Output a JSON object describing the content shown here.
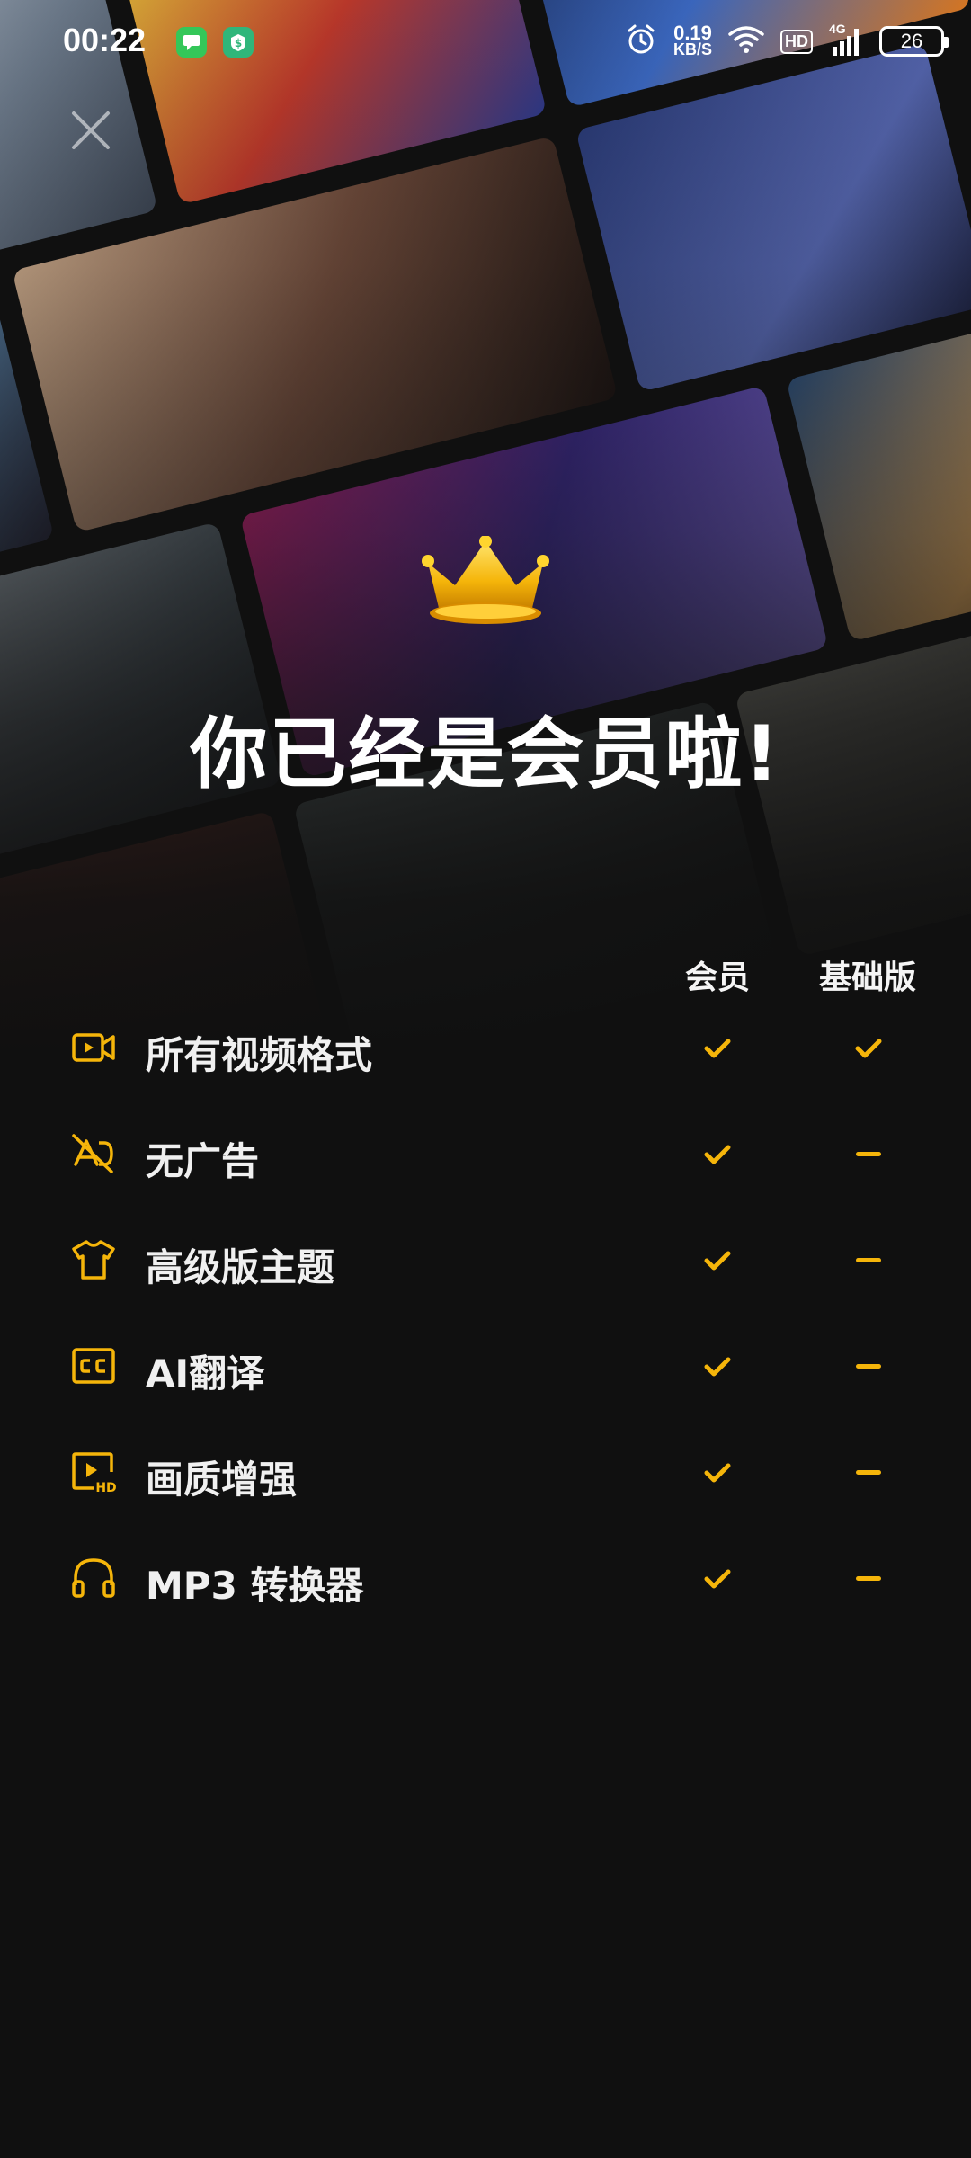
{
  "status_bar": {
    "time": "00:22",
    "net_speed_value": "0.19",
    "net_speed_unit": "KB/S",
    "hd_label": "HD",
    "signal_label": "4G",
    "battery_level": "26"
  },
  "headline": "你已经是会员啦!",
  "columns": {
    "member": "会员",
    "basic": "基础版"
  },
  "features": [
    {
      "label": "所有视频格式",
      "icon": "video-camera-icon",
      "member": true,
      "basic": true
    },
    {
      "label": "无广告",
      "icon": "no-ads-icon",
      "member": true,
      "basic": false
    },
    {
      "label": "高级版主题",
      "icon": "tshirt-icon",
      "member": true,
      "basic": false
    },
    {
      "label": "AI翻译",
      "icon": "closed-caption-icon",
      "member": true,
      "basic": false
    },
    {
      "label": "画质增强",
      "icon": "hd-video-icon",
      "member": true,
      "basic": false
    },
    {
      "label": "MP3 转换器",
      "icon": "headphones-icon",
      "member": true,
      "basic": false
    }
  ],
  "colors": {
    "accent": "#f5b50a",
    "background": "#101010",
    "text": "#f0f0f0"
  }
}
